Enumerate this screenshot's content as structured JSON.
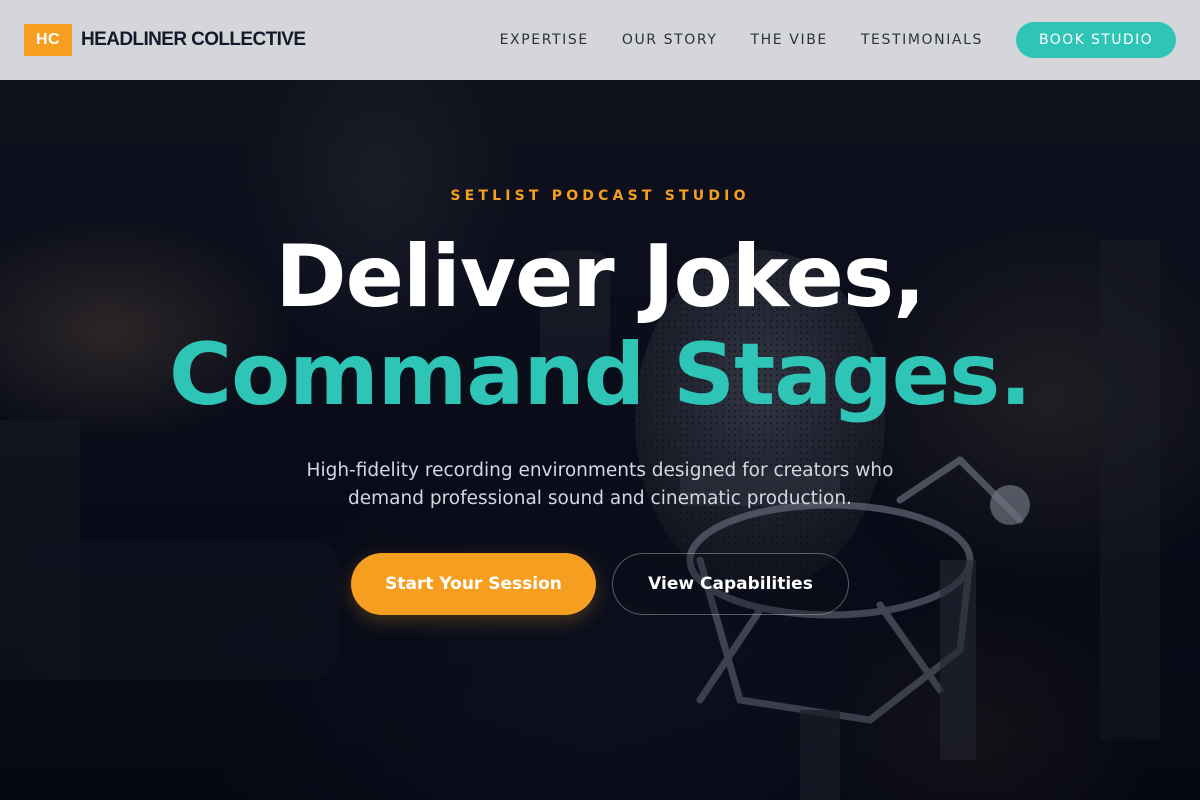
{
  "header": {
    "logo_initials": "HC",
    "brand_name": "HEADLINER COLLECTIVE",
    "nav": [
      {
        "label": "EXPERTISE"
      },
      {
        "label": "OUR STORY"
      },
      {
        "label": "THE VIBE"
      },
      {
        "label": "TESTIMONIALS"
      }
    ],
    "cta_label": "BOOK STUDIO"
  },
  "hero": {
    "eyebrow": "SETLIST PODCAST STUDIO",
    "headline_line1": "Deliver Jokes,",
    "headline_line2": "Command Stages.",
    "subtext": "High-fidelity recording environments designed for creators who demand professional sound and cinematic production.",
    "primary_button": "Start Your Session",
    "secondary_button": "View Capabilities",
    "background_image": "studio-microphone"
  },
  "colors": {
    "accent_orange": "#f59e1f",
    "accent_teal": "#2ec4b6",
    "header_bg": "#dedfe2",
    "hero_bg": "#0a0d18",
    "text_dark": "#16192a",
    "text_light": "#ffffff"
  }
}
